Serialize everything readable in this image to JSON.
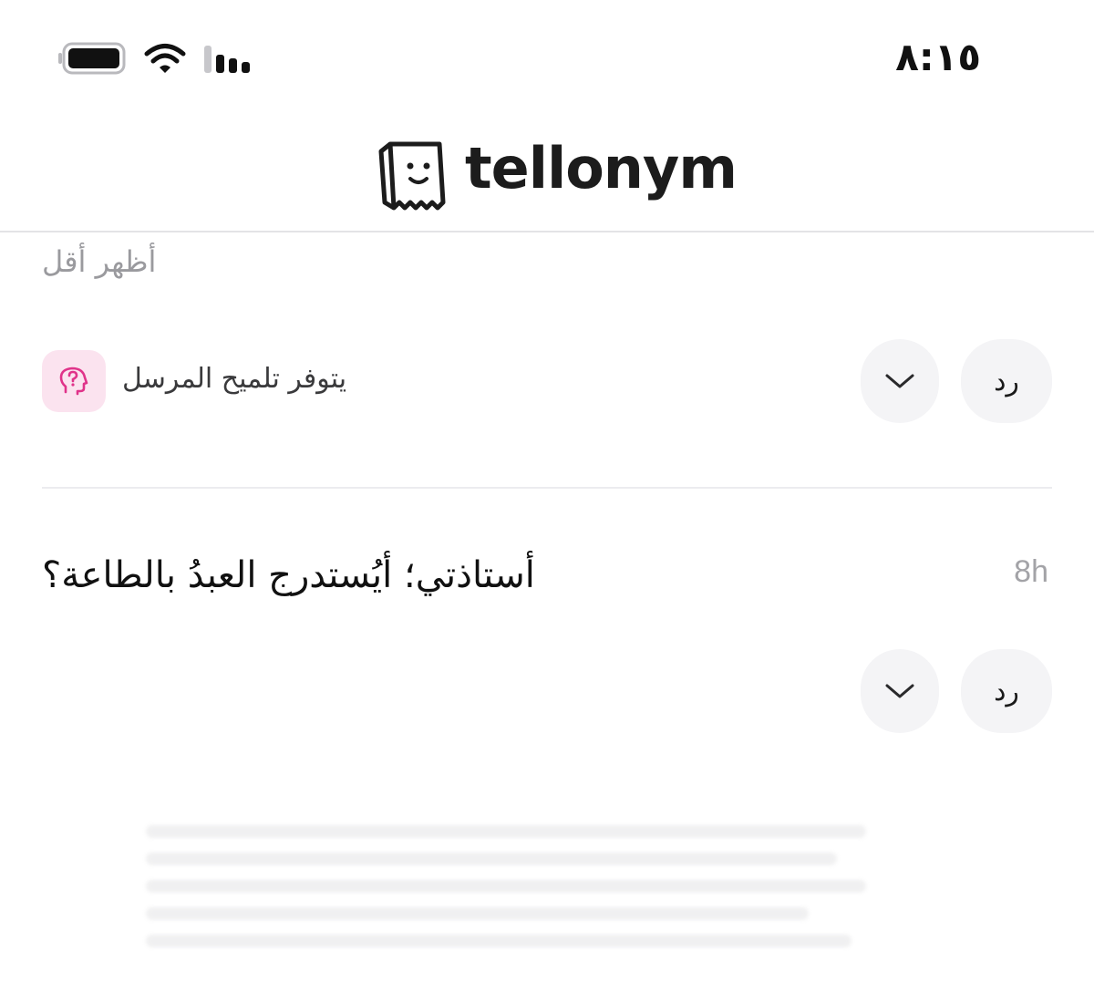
{
  "status_bar": {
    "time": "٨:١٥",
    "icons": [
      "battery-icon",
      "wifi-icon",
      "signal-icon"
    ]
  },
  "header": {
    "logo_text": "tellonym",
    "logo_icon": "paper-bag-face-icon"
  },
  "tell_1": {
    "show_less_label": "أظهر أقل",
    "reply_label": "رد",
    "more_icon": "chevron-down-icon",
    "hint_icon": "head-question-icon",
    "hint_text": "يتوفر تلميح المرسل"
  },
  "tell_2": {
    "question": "أستاذتي؛ أيُستدرج العبدُ بالطاعة؟",
    "time_ago": "8h",
    "reply_label": "رد",
    "more_icon": "chevron-down-icon"
  },
  "colors": {
    "accent_pink": "#e0338a",
    "badge_bg": "#fbe3ef",
    "button_bg": "#f4f4f6",
    "muted_text": "#9a9a9e"
  }
}
